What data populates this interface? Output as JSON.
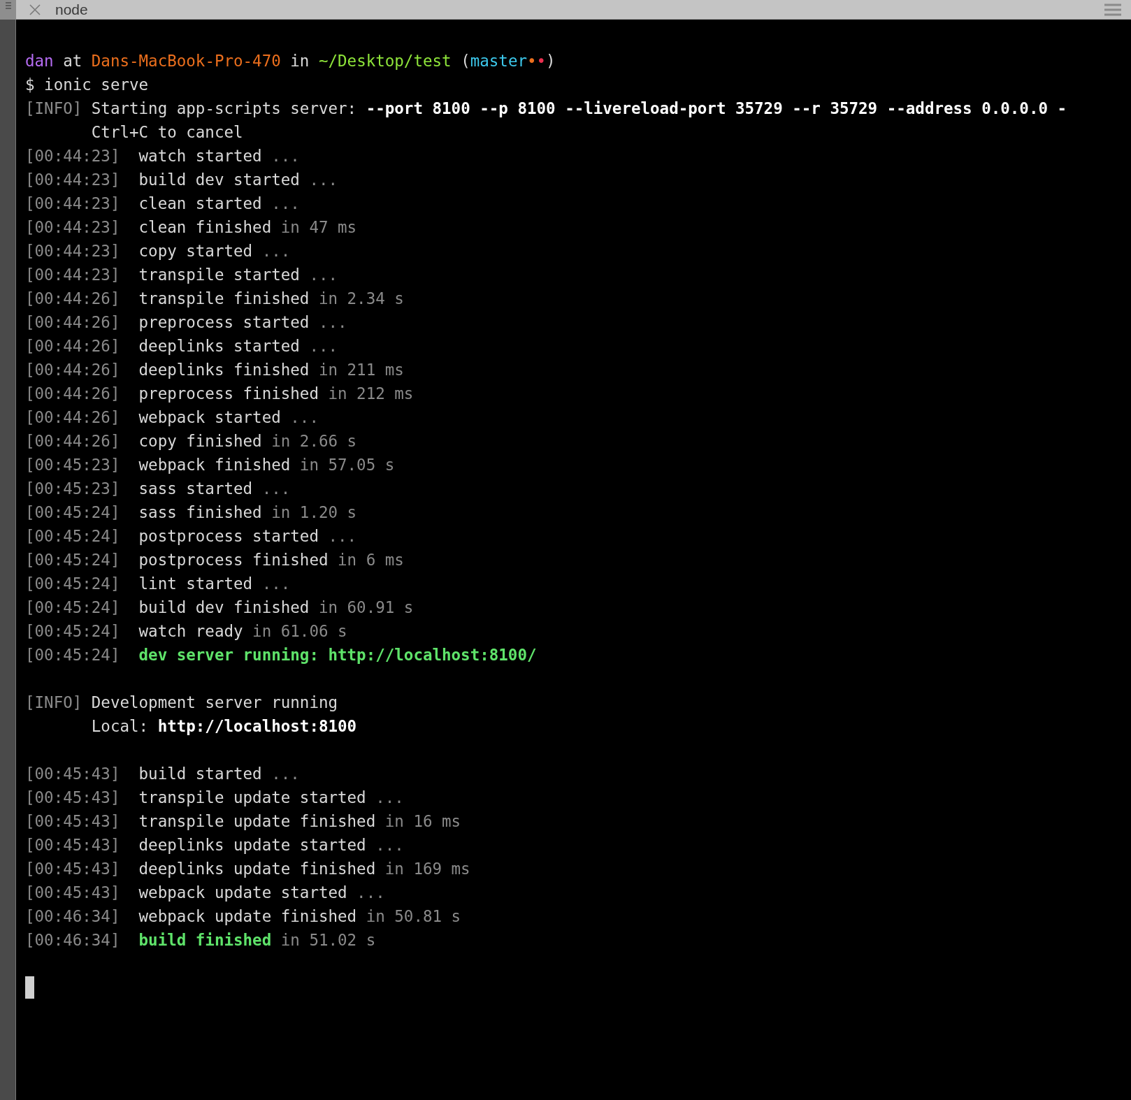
{
  "window": {
    "title": "node"
  },
  "lines": [
    {
      "kind": "blank"
    },
    {
      "kind": "prompt",
      "segments": [
        {
          "text": "dan",
          "kind": "user"
        },
        {
          "text": " at ",
          "kind": "plain"
        },
        {
          "text": "Dans-MacBook-Pro-470",
          "kind": "host"
        },
        {
          "text": " in ",
          "kind": "plain"
        },
        {
          "text": "~/Desktop/test",
          "kind": "path"
        },
        {
          "text": " (",
          "kind": "plain"
        },
        {
          "text": "master",
          "kind": "branch"
        },
        {
          "text": "•",
          "kind": "dot-orange"
        },
        {
          "text": "•",
          "kind": "dot-red"
        },
        {
          "text": ")",
          "kind": "plain"
        }
      ]
    },
    {
      "kind": "command",
      "segments": [
        {
          "text": "$ ionic serve",
          "kind": "plain"
        }
      ]
    },
    {
      "kind": "info",
      "tag": "[INFO]",
      "segments": [
        {
          "text": "Starting app-scripts server: ",
          "kind": "plain"
        },
        {
          "text": "--port 8100 --p 8100 --livereload-port 35729 --r 35729 --address 0.0.0.0 -",
          "kind": "bold"
        }
      ]
    },
    {
      "kind": "continuation",
      "segments": [
        {
          "text": "Ctrl+C to cancel",
          "kind": "plain"
        }
      ]
    },
    {
      "kind": "log",
      "timestamp": "[00:44:23]",
      "segments": [
        {
          "text": "watch started",
          "kind": "plain"
        },
        {
          "text": " ...",
          "kind": "dim"
        }
      ]
    },
    {
      "kind": "log",
      "timestamp": "[00:44:23]",
      "segments": [
        {
          "text": "build dev started",
          "kind": "plain"
        },
        {
          "text": " ...",
          "kind": "dim"
        }
      ]
    },
    {
      "kind": "log",
      "timestamp": "[00:44:23]",
      "segments": [
        {
          "text": "clean started",
          "kind": "plain"
        },
        {
          "text": " ...",
          "kind": "dim"
        }
      ]
    },
    {
      "kind": "log",
      "timestamp": "[00:44:23]",
      "segments": [
        {
          "text": "clean finished",
          "kind": "plain"
        },
        {
          "text": " in 47 ms",
          "kind": "dim"
        }
      ]
    },
    {
      "kind": "log",
      "timestamp": "[00:44:23]",
      "segments": [
        {
          "text": "copy started",
          "kind": "plain"
        },
        {
          "text": " ...",
          "kind": "dim"
        }
      ]
    },
    {
      "kind": "log",
      "timestamp": "[00:44:23]",
      "segments": [
        {
          "text": "transpile started",
          "kind": "plain"
        },
        {
          "text": " ...",
          "kind": "dim"
        }
      ]
    },
    {
      "kind": "log",
      "timestamp": "[00:44:26]",
      "segments": [
        {
          "text": "transpile finished",
          "kind": "plain"
        },
        {
          "text": " in 2.34 s",
          "kind": "dim"
        }
      ]
    },
    {
      "kind": "log",
      "timestamp": "[00:44:26]",
      "segments": [
        {
          "text": "preprocess started",
          "kind": "plain"
        },
        {
          "text": " ...",
          "kind": "dim"
        }
      ]
    },
    {
      "kind": "log",
      "timestamp": "[00:44:26]",
      "segments": [
        {
          "text": "deeplinks started",
          "kind": "plain"
        },
        {
          "text": " ...",
          "kind": "dim"
        }
      ]
    },
    {
      "kind": "log",
      "timestamp": "[00:44:26]",
      "segments": [
        {
          "text": "deeplinks finished",
          "kind": "plain"
        },
        {
          "text": " in 211 ms",
          "kind": "dim"
        }
      ]
    },
    {
      "kind": "log",
      "timestamp": "[00:44:26]",
      "segments": [
        {
          "text": "preprocess finished",
          "kind": "plain"
        },
        {
          "text": " in 212 ms",
          "kind": "dim"
        }
      ]
    },
    {
      "kind": "log",
      "timestamp": "[00:44:26]",
      "segments": [
        {
          "text": "webpack started",
          "kind": "plain"
        },
        {
          "text": " ...",
          "kind": "dim"
        }
      ]
    },
    {
      "kind": "log",
      "timestamp": "[00:44:26]",
      "segments": [
        {
          "text": "copy finished",
          "kind": "plain"
        },
        {
          "text": " in 2.66 s",
          "kind": "dim"
        }
      ]
    },
    {
      "kind": "log",
      "timestamp": "[00:45:23]",
      "segments": [
        {
          "text": "webpack finished",
          "kind": "plain"
        },
        {
          "text": " in 57.05 s",
          "kind": "dim"
        }
      ]
    },
    {
      "kind": "log",
      "timestamp": "[00:45:23]",
      "segments": [
        {
          "text": "sass started",
          "kind": "plain"
        },
        {
          "text": " ...",
          "kind": "dim"
        }
      ]
    },
    {
      "kind": "log",
      "timestamp": "[00:45:24]",
      "segments": [
        {
          "text": "sass finished",
          "kind": "plain"
        },
        {
          "text": " in 1.20 s",
          "kind": "dim"
        }
      ]
    },
    {
      "kind": "log",
      "timestamp": "[00:45:24]",
      "segments": [
        {
          "text": "postprocess started",
          "kind": "plain"
        },
        {
          "text": " ...",
          "kind": "dim"
        }
      ]
    },
    {
      "kind": "log",
      "timestamp": "[00:45:24]",
      "segments": [
        {
          "text": "postprocess finished",
          "kind": "plain"
        },
        {
          "text": " in 6 ms",
          "kind": "dim"
        }
      ]
    },
    {
      "kind": "log",
      "timestamp": "[00:45:24]",
      "segments": [
        {
          "text": "lint started",
          "kind": "plain"
        },
        {
          "text": " ...",
          "kind": "dim"
        }
      ]
    },
    {
      "kind": "log",
      "timestamp": "[00:45:24]",
      "segments": [
        {
          "text": "build dev finished",
          "kind": "plain"
        },
        {
          "text": " in 60.91 s",
          "kind": "dim"
        }
      ]
    },
    {
      "kind": "log",
      "timestamp": "[00:45:24]",
      "segments": [
        {
          "text": "watch ready",
          "kind": "plain"
        },
        {
          "text": " in 61.06 s",
          "kind": "dim"
        }
      ]
    },
    {
      "kind": "log",
      "timestamp": "[00:45:24]",
      "segments": [
        {
          "text": "dev server running: http://localhost:8100/",
          "kind": "green"
        }
      ]
    },
    {
      "kind": "blank"
    },
    {
      "kind": "info",
      "tag": "[INFO]",
      "segments": [
        {
          "text": "Development server running",
          "kind": "plain"
        }
      ]
    },
    {
      "kind": "continuation",
      "segments": [
        {
          "text": "Local: ",
          "kind": "plain"
        },
        {
          "text": "http://localhost:8100",
          "kind": "bold"
        }
      ]
    },
    {
      "kind": "blank"
    },
    {
      "kind": "log",
      "timestamp": "[00:45:43]",
      "segments": [
        {
          "text": "build started",
          "kind": "plain"
        },
        {
          "text": " ...",
          "kind": "dim"
        }
      ]
    },
    {
      "kind": "log",
      "timestamp": "[00:45:43]",
      "segments": [
        {
          "text": "transpile update started",
          "kind": "plain"
        },
        {
          "text": " ...",
          "kind": "dim"
        }
      ]
    },
    {
      "kind": "log",
      "timestamp": "[00:45:43]",
      "segments": [
        {
          "text": "transpile update finished",
          "kind": "plain"
        },
        {
          "text": " in 16 ms",
          "kind": "dim"
        }
      ]
    },
    {
      "kind": "log",
      "timestamp": "[00:45:43]",
      "segments": [
        {
          "text": "deeplinks update started",
          "kind": "plain"
        },
        {
          "text": " ...",
          "kind": "dim"
        }
      ]
    },
    {
      "kind": "log",
      "timestamp": "[00:45:43]",
      "segments": [
        {
          "text": "deeplinks update finished",
          "kind": "plain"
        },
        {
          "text": " in 169 ms",
          "kind": "dim"
        }
      ]
    },
    {
      "kind": "log",
      "timestamp": "[00:45:43]",
      "segments": [
        {
          "text": "webpack update started",
          "kind": "plain"
        },
        {
          "text": " ...",
          "kind": "dim"
        }
      ]
    },
    {
      "kind": "log",
      "timestamp": "[00:46:34]",
      "segments": [
        {
          "text": "webpack update finished",
          "kind": "plain"
        },
        {
          "text": " in 50.81 s",
          "kind": "dim"
        }
      ]
    },
    {
      "kind": "log",
      "timestamp": "[00:46:34]",
      "segments": [
        {
          "text": "build finished",
          "kind": "green"
        },
        {
          "text": " in 51.02 s",
          "kind": "dim"
        }
      ]
    },
    {
      "kind": "blank"
    },
    {
      "kind": "cursor"
    }
  ]
}
